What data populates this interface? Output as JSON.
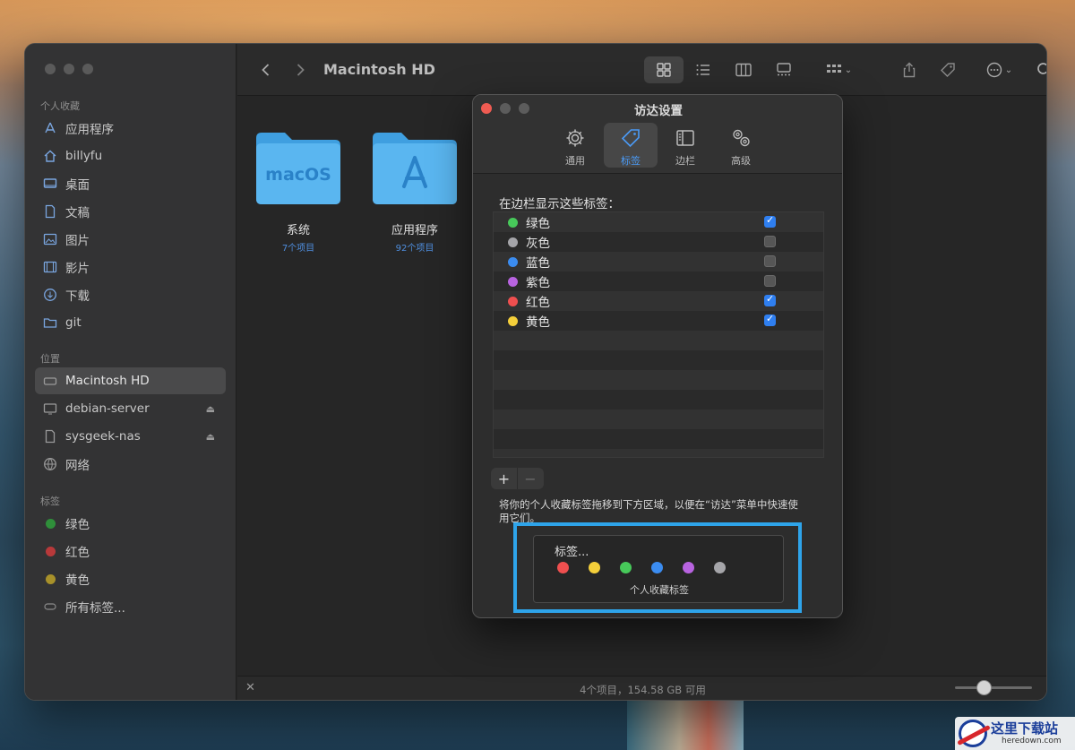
{
  "finder": {
    "title": "Macintosh HD",
    "sidebar": {
      "favorites_header": "个人收藏",
      "favorites": [
        {
          "label": "应用程序",
          "icon": "apps-icon"
        },
        {
          "label": "billyfu",
          "icon": "home-icon"
        },
        {
          "label": "桌面",
          "icon": "desktop-icon"
        },
        {
          "label": "文稿",
          "icon": "document-icon"
        },
        {
          "label": "图片",
          "icon": "photo-icon"
        },
        {
          "label": "影片",
          "icon": "film-icon"
        },
        {
          "label": "下载",
          "icon": "download-icon"
        },
        {
          "label": "git",
          "icon": "folder-icon"
        }
      ],
      "locations_header": "位置",
      "locations": [
        {
          "label": "Macintosh HD",
          "icon": "disk-icon",
          "selected": true
        },
        {
          "label": "debian-server",
          "icon": "server-icon",
          "eject": true
        },
        {
          "label": "sysgeek-nas",
          "icon": "nas-icon",
          "eject": true
        },
        {
          "label": "网络",
          "icon": "network-icon"
        }
      ],
      "tags_header": "标签",
      "tags": [
        {
          "label": "绿色",
          "color": "#2f8f3a"
        },
        {
          "label": "红色",
          "color": "#b8393a"
        },
        {
          "label": "黄色",
          "color": "#a8912a"
        },
        {
          "label": "所有标签...",
          "color": ""
        }
      ]
    },
    "folders": [
      {
        "badge": "macOS",
        "name": "系统",
        "count": "7个项目"
      },
      {
        "badge": "",
        "name": "应用程序",
        "count": "92个项目"
      }
    ],
    "status": "4个项目，154.58 GB 可用"
  },
  "dialog": {
    "title": "访达设置",
    "tabs": [
      {
        "label": "通用",
        "icon": "gear-icon"
      },
      {
        "label": "标签",
        "icon": "tag-icon",
        "active": true
      },
      {
        "label": "边栏",
        "icon": "sidebar-icon"
      },
      {
        "label": "高级",
        "icon": "gears-icon"
      }
    ],
    "list_label": "在边栏显示这些标签：",
    "tags": [
      {
        "name": "绿色",
        "color": "#47c95a",
        "checked": true
      },
      {
        "name": "灰色",
        "color": "#a5a5a9",
        "checked": false
      },
      {
        "name": "蓝色",
        "color": "#3b8cf0",
        "checked": false
      },
      {
        "name": "紫色",
        "color": "#b863e0",
        "checked": false
      },
      {
        "name": "红色",
        "color": "#ef4f4f",
        "checked": true
      },
      {
        "name": "黄色",
        "color": "#f4cf3a",
        "checked": true
      }
    ],
    "add_label": "+",
    "remove_label": "−",
    "hint": "将你的个人收藏标签拖移到下方区域，以便在“访达”菜单中快速使用它们。",
    "favorites_title": "标签...",
    "favorites_colors": [
      "#ef4f4f",
      "#f4cf3a",
      "#47c95a",
      "#3b8cf0",
      "#b863e0",
      "#a5a5a9"
    ],
    "favorites_caption": "个人收藏标签"
  },
  "watermark": {
    "title": "这里下载站",
    "sub": "heredown.com"
  }
}
